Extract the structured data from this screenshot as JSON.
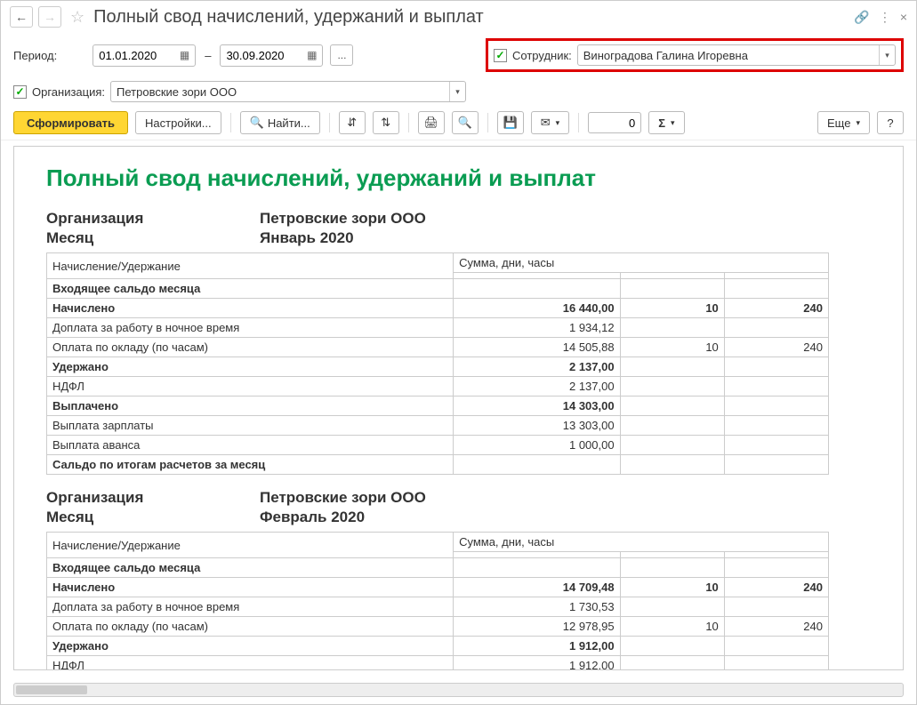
{
  "title": "Полный свод начислений, удержаний и выплат",
  "period_label": "Период:",
  "date_from": "01.01.2020",
  "date_to": "30.09.2020",
  "employee_label": "Сотрудник:",
  "employee_value": "Виноградова Галина Игоревна",
  "org_label": "Организация:",
  "org_value": "Петровские зори ООО",
  "toolbar": {
    "generate": "Сформировать",
    "settings": "Настройки...",
    "find": "Найти...",
    "more": "Еще",
    "number": "0"
  },
  "report": {
    "title": "Полный свод начислений, удержаний и выплат",
    "blocks": [
      {
        "org_label": "Организация",
        "org_value": "Петровские зори ООО",
        "month_label": "Месяц",
        "month_value": "Январь 2020",
        "header_name": "Начисление/Удержание",
        "header_sum": "Сумма, дни, часы",
        "rows": [
          {
            "bold": true,
            "name": "Входящее сальдо месяца",
            "sum": "",
            "days": "",
            "hours": ""
          },
          {
            "bold": true,
            "name": "Начислено",
            "sum": "16 440,00",
            "days": "10",
            "hours": "240"
          },
          {
            "bold": false,
            "name": "Доплата за работу в ночное время",
            "sum": "1 934,12",
            "days": "",
            "hours": ""
          },
          {
            "bold": false,
            "name": "Оплата по окладу (по часам)",
            "sum": "14 505,88",
            "days": "10",
            "hours": "240"
          },
          {
            "bold": true,
            "name": "Удержано",
            "sum": "2 137,00",
            "days": "",
            "hours": ""
          },
          {
            "bold": false,
            "name": "НДФЛ",
            "sum": "2 137,00",
            "days": "",
            "hours": ""
          },
          {
            "bold": true,
            "name": "Выплачено",
            "sum": "14 303,00",
            "days": "",
            "hours": ""
          },
          {
            "bold": false,
            "name": "Выплата зарплаты",
            "sum": "13 303,00",
            "days": "",
            "hours": ""
          },
          {
            "bold": false,
            "name": "Выплата аванса",
            "sum": "1 000,00",
            "days": "",
            "hours": ""
          },
          {
            "bold": true,
            "name": "Сальдо по итогам расчетов за месяц",
            "sum": "",
            "days": "",
            "hours": ""
          }
        ]
      },
      {
        "org_label": "Организация",
        "org_value": "Петровские зори ООО",
        "month_label": "Месяц",
        "month_value": "Февраль 2020",
        "header_name": "Начисление/Удержание",
        "header_sum": "Сумма, дни, часы",
        "rows": [
          {
            "bold": true,
            "name": "Входящее сальдо месяца",
            "sum": "",
            "days": "",
            "hours": ""
          },
          {
            "bold": true,
            "name": "Начислено",
            "sum": "14 709,48",
            "days": "10",
            "hours": "240"
          },
          {
            "bold": false,
            "name": "Доплата за работу в ночное время",
            "sum": "1 730,53",
            "days": "",
            "hours": ""
          },
          {
            "bold": false,
            "name": "Оплата по окладу (по часам)",
            "sum": "12 978,95",
            "days": "10",
            "hours": "240"
          },
          {
            "bold": true,
            "name": "Удержано",
            "sum": "1 912,00",
            "days": "",
            "hours": ""
          },
          {
            "bold": false,
            "name": "НДФЛ",
            "sum": "1 912,00",
            "days": "",
            "hours": ""
          }
        ]
      }
    ]
  }
}
